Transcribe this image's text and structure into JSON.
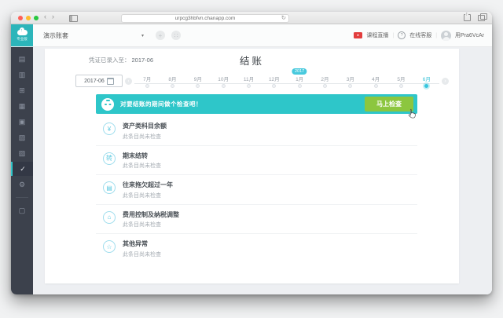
{
  "browser": {
    "url": "urpcg3hbfvn.chanapp.com",
    "back_icon": "‹",
    "forward_icon": "›",
    "refresh_icon": "↻"
  },
  "topbar": {
    "edition": "专业版",
    "account_set": "演示账套",
    "caret": "▾",
    "add_button": "+",
    "grid_button": "∷",
    "live_label": "课程直播",
    "support_label": "在线客服",
    "user_name": "用Pra6VcAr"
  },
  "sidebar": {
    "items": [
      {
        "id": "nav-1",
        "glyph": "▤",
        "active": false
      },
      {
        "id": "nav-2",
        "glyph": "▥",
        "active": false
      },
      {
        "id": "nav-3",
        "glyph": "⊞",
        "active": false
      },
      {
        "id": "nav-4",
        "glyph": "▦",
        "active": false
      },
      {
        "id": "nav-5",
        "glyph": "▣",
        "active": false
      },
      {
        "id": "nav-6",
        "glyph": "▧",
        "active": false
      },
      {
        "id": "nav-7",
        "glyph": "▨",
        "active": false
      },
      {
        "id": "closing",
        "glyph": "✓",
        "active": true
      },
      {
        "id": "settings",
        "glyph": "⚙",
        "active": false
      },
      {
        "divider": true
      },
      {
        "id": "archive",
        "glyph": "▢",
        "active": false
      }
    ]
  },
  "content": {
    "entered_label": "凭证已录入至：",
    "entered_value": "2017-06",
    "page_title": "结账",
    "timeline": {
      "date_value": "2017-06",
      "prev_icon": "‹",
      "next_icon": "›",
      "year_badge": "2017",
      "year_badge_month_index": 6,
      "active_month_index": 11,
      "months": [
        "7月",
        "8月",
        "9月",
        "10月",
        "11月",
        "12月",
        "1月",
        "2月",
        "3月",
        "4月",
        "5月",
        "6月"
      ]
    },
    "banner": {
      "message": "对要结账的期间做个检查吧！",
      "button_label": "马上检查"
    },
    "check_items": [
      {
        "glyph": "¥",
        "icon": "currency-icon",
        "title": "资产类科目余额",
        "status": "此条目尚未检查"
      },
      {
        "glyph": "转",
        "icon": "carryover-icon",
        "title": "期末结转",
        "status": "此条目尚未检查"
      },
      {
        "glyph": "▤",
        "icon": "document-icon",
        "title": "往来拖欠超过一年",
        "status": "此条目尚未检查"
      },
      {
        "glyph": "⌂",
        "icon": "tax-icon",
        "title": "费用控制及纳税调整",
        "status": "此条目尚未检查"
      },
      {
        "glyph": "☆",
        "icon": "star-icon",
        "title": "其他异常",
        "status": "此条目尚未检查"
      }
    ]
  },
  "colors": {
    "accent_teal": "#2ec6c9",
    "timeline_cyan": "#47c9dd",
    "button_green": "#8cc63f",
    "sidebar_bg": "#3c414c",
    "logo_teal": "#2cb5ba",
    "traffic_red": "#ff5f57",
    "traffic_yellow": "#febc2e",
    "traffic_green": "#28c840"
  }
}
